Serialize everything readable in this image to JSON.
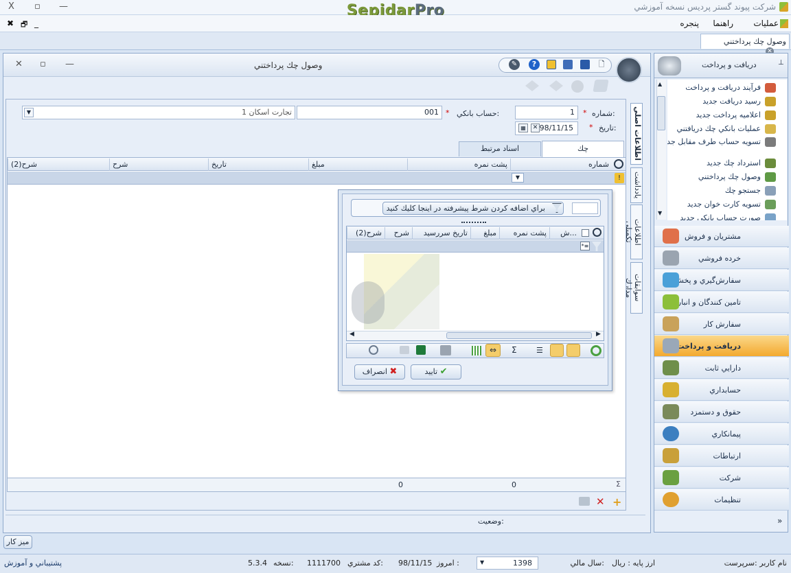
{
  "app": {
    "title_right": "شركت پيوند گستر پرديس نسخه آموزشي",
    "logo_a": "Sepidar",
    "logo_b": "Pro",
    "close": "X",
    "restore": "▫",
    "minimize": "—"
  },
  "menu": {
    "items": [
      "عمليات",
      "راهنما",
      "پنجره"
    ],
    "mdi_close": "✖",
    "mdi_restore": "🗗",
    "mdi_min": "_"
  },
  "doc_tab": {
    "label": "وصول چك پرداختني"
  },
  "form": {
    "title": "وصول چك پرداختني",
    "number_label": "شماره:",
    "number_value": "1",
    "date_label": "تاريخ:",
    "date_value": "98/11/15",
    "bank_label": "حساب بانكي:",
    "bank_code": "001",
    "bank_name": "تجارت اسكان 1",
    "required": "*",
    "tabs": [
      "چك",
      "اسناد مرتبط"
    ],
    "vtabs": [
      "اطلاعات اصلي",
      "يادداشت",
      "اطلاعات تكميلي",
      "سوابقات مدارك"
    ],
    "grid_headers": [
      "شماره",
      "پشت نمره",
      "مبلغ",
      "تاريخ",
      "شرح",
      "شرح(2)"
    ],
    "footer_count": "0",
    "footer_sum": "0",
    "status_label": "وضعيت:"
  },
  "popup": {
    "filter_text": "براي اضافه كردن شرط پيشرفته در اينجا كليك كنيد",
    "headers": [
      "ش...",
      "پشت نمره",
      "مبلغ",
      "تاريخ سررسيد",
      "شرح",
      "شرح(2)"
    ],
    "ok": "تاييد",
    "cancel": "انصراف"
  },
  "sidebar": {
    "header": "دريافت و پرداخت",
    "pin": "📌",
    "items": [
      {
        "label": "فرآيند دريافت و پرداخت",
        "color": "#d35c3c"
      },
      {
        "label": "رسيد دريافت جديد",
        "color": "#c9a12a"
      },
      {
        "label": "اعلاميه پرداخت جديد",
        "color": "#c9a12a"
      },
      {
        "label": "عمليات بانكي چك دريافتني",
        "color": "#d8b64a"
      },
      {
        "label": "تسويه حساب طرف مقابل جديد",
        "color": "#7b7b7b"
      },
      {
        "label": "استرداد چك جديد",
        "color": "#6b8c3b"
      },
      {
        "label": "وصول چك پرداختني",
        "color": "#5f9a45"
      },
      {
        "label": "جستجو چك",
        "color": "#8aa0b8"
      },
      {
        "label": "تسويه كارت خوان جديد",
        "color": "#6b9e5a"
      },
      {
        "label": "صورت حساب بانكي جديد",
        "color": "#7aa3c8"
      }
    ],
    "nav": [
      {
        "label": "مشتريان و فروش",
        "color": "#e0704a"
      },
      {
        "label": "خرده فروشي",
        "color": "#9aa4b0"
      },
      {
        "label": "سفارش‌گيري و پخش",
        "color": "#4aa0d8"
      },
      {
        "label": "تامين كنندگان و انبار",
        "color": "#8cbf3a"
      },
      {
        "label": "سفارش كار",
        "color": "#c9a25a"
      },
      {
        "label": "دريافت و پرداخت",
        "color": "#9aa8b8",
        "active": true
      },
      {
        "label": "دارايي ثابت",
        "color": "#6f8f4a"
      },
      {
        "label": "حسابداري",
        "color": "#d8b030"
      },
      {
        "label": "حقوق و دستمزد",
        "color": "#7a8a5a"
      },
      {
        "label": "پيمانكاري",
        "color": "#3c7fc0"
      },
      {
        "label": "ارتباطات",
        "color": "#c9a03a"
      },
      {
        "label": "شركت",
        "color": "#6aa040"
      },
      {
        "label": "تنظيمات",
        "color": "#e0a030"
      }
    ],
    "more": "»"
  },
  "desk_button": "ميز كار",
  "status": {
    "user": "نام كاربر :سرپرست",
    "currency": "ارز پايه :    ريال",
    "fiscal_label": "سال مالي:",
    "fiscal_value": "1398",
    "today_label": "امروز :",
    "today_value": "98/11/15",
    "customer_label": "كد مشتري:",
    "customer_value": "1111700",
    "version_label": "نسخه:",
    "version_value": "5.3.4",
    "support": "پشتيباني و آموزش"
  }
}
